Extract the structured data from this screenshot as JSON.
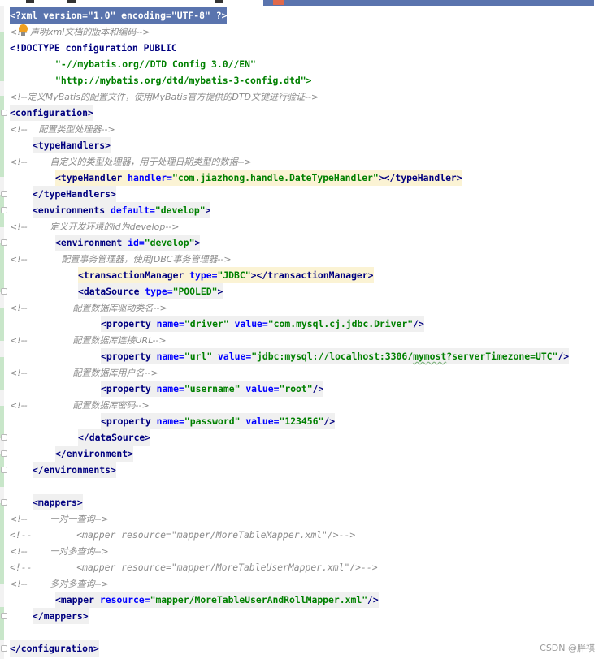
{
  "lines": {
    "xml_decl": "<?xml version=\"1.0\" encoding=\"UTF-8\" ?>",
    "comment_decl": "<!-- 声明xml文档的版本和编码-->",
    "doctype_kw": "<!DOCTYPE",
    "doctype_rest": " configuration PUBLIC",
    "doctype_pub": "\"-//mybatis.org//DTD Config 3.0//EN\"",
    "doctype_url": "\"http://mybatis.org/dtd/mybatis-3-config.dtd\">",
    "comment_config": "<!--定义MyBatis的配置文件，使用MyBatis官方提供的DTD文键进行验证-->",
    "configuration_open": "<configuration>",
    "comment_typehandler": "<!--    配置类型处理器-->",
    "typehandlers_open": "<typeHandlers>",
    "comment_custom_handler": "<!--        自定义的类型处理器，用于处理日期类型的数据-->",
    "typehandler_tag": "<typeHandler",
    "typehandler_attr": " handler=",
    "typehandler_val": "\"com.jiazhong.handle.DateTypeHandler\"",
    "typehandler_close": "></typeHandler>",
    "typehandlers_close": "</typeHandlers>",
    "environments_tag": "<environments",
    "environments_attr": " default=",
    "environments_val": "\"develop\"",
    "environments_end": ">",
    "comment_env": "<!--        定义开发环境的id为develop-->",
    "environment_tag": "<environment",
    "environment_attr": " id=",
    "environment_val": "\"develop\"",
    "environment_end": ">",
    "comment_tx": "<!--            配置事务管理器，使用JDBC事务管理器-->",
    "tx_tag": "<transactionManager",
    "tx_attr": " type=",
    "tx_val": "\"JDBC\"",
    "tx_close": "></transactionManager>",
    "ds_tag": "<dataSource",
    "ds_attr": " type=",
    "ds_val": "\"POOLED\"",
    "ds_end": ">",
    "comment_driver": "<!--                配置数据库驱动类名-->",
    "prop_tag": "<property",
    "name_attr": " name=",
    "value_attr": " value=",
    "prop_end": "/>",
    "driver_name": "\"driver\"",
    "driver_value": "\"com.mysql.cj.jdbc.Driver\"",
    "comment_url": "<!--                配置数据库连接URL-->",
    "url_name": "\"url\"",
    "url_value_pre": "\"jdbc:mysql://localhost:3306/",
    "url_value_db": "mymost",
    "url_value_post": "?serverTimezone=UTC\"",
    "comment_user": "<!--                配置数据库用户名-->",
    "user_name": "\"username\"",
    "user_value": "\"root\"",
    "comment_pwd": "<!--                配置数据库密码-->",
    "pwd_name": "\"password\"",
    "pwd_value": "\"123456\"",
    "ds_close": "</dataSource>",
    "environment_close": "</environment>",
    "environments_close": "</environments>",
    "mappers_open": "<mappers>",
    "comment_one_to_one": "<!--        一对一查询-->",
    "comment_mapper1": "<!--        <mapper resource=\"mapper/MoreTableMapper.xml\"/>-->",
    "comment_one_to_many": "<!--        一对多查询-->",
    "comment_mapper2": "<!--        <mapper resource=\"mapper/MoreTableUserMapper.xml\"/>-->",
    "comment_many_to_many": "<!--        多对多查询-->",
    "mapper_tag": "<mapper",
    "mapper_attr": " resource=",
    "mapper_val": "\"mapper/MoreTableUserAndRollMapper.xml\"",
    "mapper_end": "/>",
    "mappers_close": "</mappers>",
    "configuration_close": "</configuration>"
  },
  "watermark": "CSDN @胖祺",
  "colors": {
    "tag": "#000080",
    "attribute": "#0000ff",
    "string": "#008000",
    "comment": "#8c8c8c",
    "selection": "#5a74ae",
    "tag_highlight": "#fbf3d4"
  }
}
